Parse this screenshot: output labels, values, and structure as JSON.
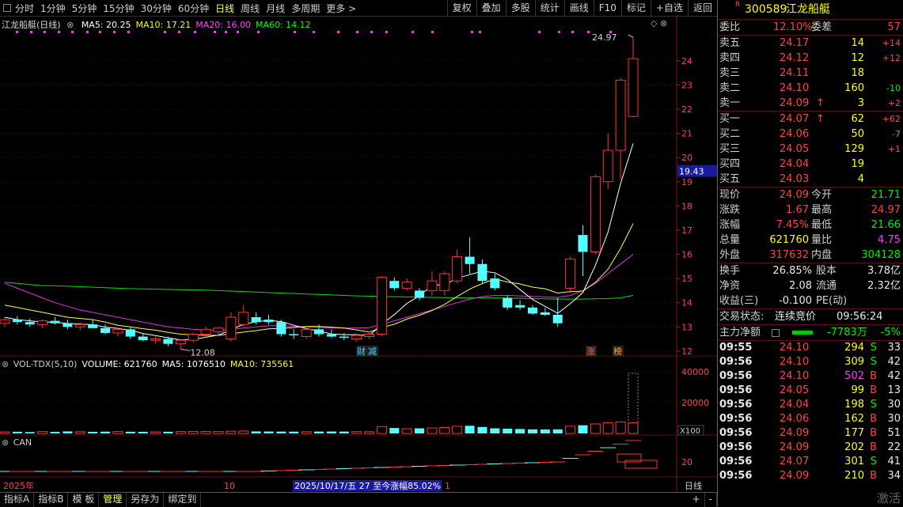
{
  "toolbar": {
    "periods": [
      "分时",
      "1分钟",
      "5分钟",
      "15分钟",
      "30分钟",
      "60分钟",
      "日线",
      "周线",
      "月线",
      "多周期",
      "更多 >"
    ],
    "active_period": "日线",
    "tools": [
      "复权",
      "叠加",
      "多股",
      "统计",
      "画线",
      "F10",
      "标记",
      "+自选",
      "返回"
    ]
  },
  "stock": {
    "code": "300589",
    "name": "江龙船艇",
    "badge": "R"
  },
  "ma_info": {
    "title": "江龙船艇(日线)",
    "items": [
      {
        "label": "MA5: 20.25",
        "color": "#ffffff"
      },
      {
        "label": "MA10: 17.21",
        "color": "#ffff00"
      },
      {
        "label": "MA20: 16.00",
        "color": "#ff44ff"
      },
      {
        "label": "MA60: 14.12",
        "color": "#00ff00"
      }
    ]
  },
  "vol_info": {
    "items": [
      {
        "label": "VOL-TDX(5,10)",
        "color": "#cccccc"
      },
      {
        "label": "VOLUME: 621760",
        "color": "#ffffff"
      },
      {
        "label": "MA5: 1076510",
        "color": "#ffffff"
      },
      {
        "label": "MA10: 735561",
        "color": "#ffff00"
      }
    ]
  },
  "can_info": {
    "label": "CAN"
  },
  "chart_labels": {
    "high_mark": "24.97",
    "low_mark": "12.08",
    "current_price": "19.43",
    "tag_cai": "财",
    "tag_jian": "减",
    "tag_zhang": "涨",
    "tag_bang": "榜",
    "vol_scale": "X100",
    "date_left": "2025年",
    "date_mid": "10",
    "date_range": "2025/10/17/五 27 至今涨幅85.02%",
    "date_end": "1"
  },
  "chart_data": {
    "type": "candlestick",
    "price_axis": {
      "ticks": [
        12,
        13,
        14,
        15,
        16,
        17,
        18,
        19,
        20,
        21,
        22,
        23,
        24
      ],
      "range": [
        11.8,
        25.4
      ]
    },
    "vol_axis": {
      "ticks": [
        20000,
        40000
      ]
    },
    "can_axis": {
      "ticks": [
        20
      ]
    },
    "candles": [
      {
        "o": 13.15,
        "h": 13.4,
        "l": 13.0,
        "c": 13.3
      },
      {
        "o": 13.3,
        "h": 13.45,
        "l": 13.1,
        "c": 13.2
      },
      {
        "o": 13.2,
        "h": 13.35,
        "l": 13.0,
        "c": 13.1
      },
      {
        "o": 13.1,
        "h": 13.3,
        "l": 12.95,
        "c": 13.25
      },
      {
        "o": 13.25,
        "h": 13.4,
        "l": 13.1,
        "c": 13.15
      },
      {
        "o": 13.15,
        "h": 13.3,
        "l": 12.9,
        "c": 13.0
      },
      {
        "o": 13.0,
        "h": 13.2,
        "l": 12.85,
        "c": 13.1
      },
      {
        "o": 13.1,
        "h": 13.3,
        "l": 12.95,
        "c": 12.95
      },
      {
        "o": 12.95,
        "h": 13.1,
        "l": 12.7,
        "c": 12.75
      },
      {
        "o": 12.75,
        "h": 12.95,
        "l": 12.6,
        "c": 12.9
      },
      {
        "o": 12.9,
        "h": 13.0,
        "l": 12.5,
        "c": 12.6
      },
      {
        "o": 12.6,
        "h": 12.75,
        "l": 12.4,
        "c": 12.45
      },
      {
        "o": 12.45,
        "h": 12.6,
        "l": 12.3,
        "c": 12.5
      },
      {
        "o": 12.5,
        "h": 12.6,
        "l": 12.2,
        "c": 12.3
      },
      {
        "o": 12.3,
        "h": 12.5,
        "l": 12.08,
        "c": 12.45
      },
      {
        "o": 12.45,
        "h": 12.75,
        "l": 12.35,
        "c": 12.7
      },
      {
        "o": 12.7,
        "h": 13.0,
        "l": 12.55,
        "c": 12.9
      },
      {
        "o": 12.8,
        "h": 13.0,
        "l": 12.6,
        "c": 12.95
      },
      {
        "o": 12.5,
        "h": 13.6,
        "l": 12.4,
        "c": 13.4
      },
      {
        "o": 13.1,
        "h": 13.9,
        "l": 13.0,
        "c": 13.6
      },
      {
        "o": 13.4,
        "h": 13.6,
        "l": 13.1,
        "c": 13.2
      },
      {
        "o": 13.3,
        "h": 13.5,
        "l": 13.1,
        "c": 13.2
      },
      {
        "o": 13.2,
        "h": 13.3,
        "l": 12.6,
        "c": 12.7
      },
      {
        "o": 12.7,
        "h": 12.9,
        "l": 12.5,
        "c": 12.65
      },
      {
        "o": 12.6,
        "h": 12.95,
        "l": 12.5,
        "c": 12.9
      },
      {
        "o": 12.9,
        "h": 13.1,
        "l": 12.6,
        "c": 12.7
      },
      {
        "o": 12.7,
        "h": 12.9,
        "l": 12.55,
        "c": 12.6
      },
      {
        "o": 12.6,
        "h": 12.75,
        "l": 12.45,
        "c": 12.55
      },
      {
        "o": 12.5,
        "h": 12.7,
        "l": 12.4,
        "c": 12.65
      },
      {
        "o": 12.6,
        "h": 12.8,
        "l": 12.5,
        "c": 12.7
      },
      {
        "o": 12.7,
        "h": 15.1,
        "l": 12.6,
        "c": 15.05
      },
      {
        "o": 14.9,
        "h": 15.05,
        "l": 14.5,
        "c": 14.6
      },
      {
        "o": 14.6,
        "h": 15.0,
        "l": 14.5,
        "c": 14.85
      },
      {
        "o": 14.5,
        "h": 14.6,
        "l": 14.1,
        "c": 14.2
      },
      {
        "o": 14.5,
        "h": 15.3,
        "l": 14.3,
        "c": 14.9
      },
      {
        "o": 14.5,
        "h": 15.3,
        "l": 14.3,
        "c": 15.2
      },
      {
        "o": 14.9,
        "h": 16.2,
        "l": 14.8,
        "c": 15.9
      },
      {
        "o": 15.9,
        "h": 16.7,
        "l": 15.2,
        "c": 15.6
      },
      {
        "o": 15.6,
        "h": 15.8,
        "l": 14.8,
        "c": 14.9
      },
      {
        "o": 15.0,
        "h": 15.2,
        "l": 14.5,
        "c": 14.6
      },
      {
        "o": 14.2,
        "h": 14.3,
        "l": 13.7,
        "c": 13.8
      },
      {
        "o": 13.9,
        "h": 14.1,
        "l": 13.7,
        "c": 13.8
      },
      {
        "o": 13.8,
        "h": 13.9,
        "l": 13.5,
        "c": 13.55
      },
      {
        "o": 13.6,
        "h": 13.8,
        "l": 13.45,
        "c": 13.5
      },
      {
        "o": 13.5,
        "h": 14.2,
        "l": 13.0,
        "c": 13.15
      },
      {
        "o": 14.6,
        "h": 15.9,
        "l": 14.4,
        "c": 15.8
      },
      {
        "o": 16.8,
        "h": 17.2,
        "l": 15.1,
        "c": 16.1
      },
      {
        "o": 16.1,
        "h": 19.3,
        "l": 16.0,
        "c": 19.2
      },
      {
        "o": 19.0,
        "h": 21.0,
        "l": 18.7,
        "c": 20.3
      },
      {
        "o": 20.3,
        "h": 23.3,
        "l": 19.1,
        "c": 23.2
      },
      {
        "o": 21.7,
        "h": 24.97,
        "l": 21.66,
        "c": 24.09
      }
    ],
    "volumes": [
      900,
      1000,
      800,
      1100,
      900,
      1200,
      1000,
      950,
      1050,
      1100,
      1000,
      950,
      900,
      1000,
      1100,
      1200,
      1150,
      1100,
      1300,
      1400,
      1200,
      1150,
      1100,
      1050,
      1000,
      1100,
      1150,
      1100,
      1050,
      1000,
      4000,
      3200,
      2800,
      3000,
      3200,
      3500,
      4200,
      4500,
      3800,
      3000,
      2800,
      2600,
      2400,
      2300,
      2400,
      4200,
      4800,
      5600,
      6300,
      6800,
      6217
    ]
  },
  "quote": {
    "weibi": "12.10%",
    "weicha": "57",
    "asks": [
      {
        "label": "卖五",
        "price": "24.17",
        "vol": "14",
        "chg": "+14"
      },
      {
        "label": "卖四",
        "price": "24.12",
        "vol": "12",
        "chg": "+12"
      },
      {
        "label": "卖三",
        "price": "24.11",
        "vol": "18",
        "chg": ""
      },
      {
        "label": "卖二",
        "price": "24.10",
        "vol": "160",
        "chg": "-10"
      },
      {
        "label": "卖一",
        "price": "24.09",
        "vol": "3",
        "chg": "+2",
        "arrow": "↑"
      }
    ],
    "bids": [
      {
        "label": "买一",
        "price": "24.07",
        "vol": "62",
        "chg": "+62",
        "arrow": "↑"
      },
      {
        "label": "买二",
        "price": "24.06",
        "vol": "50",
        "chg": "-7"
      },
      {
        "label": "买三",
        "price": "24.05",
        "vol": "129",
        "chg": "+1"
      },
      {
        "label": "买四",
        "price": "24.04",
        "vol": "19",
        "chg": ""
      },
      {
        "label": "买五",
        "price": "24.03",
        "vol": "4",
        "chg": ""
      }
    ],
    "stats": [
      {
        "l1": "现价",
        "v1": "24.09",
        "c1": "red",
        "l2": "今开",
        "v2": "21.71",
        "c2": "green"
      },
      {
        "l1": "涨跌",
        "v1": "1.67",
        "c1": "red",
        "l2": "最高",
        "v2": "24.97",
        "c2": "red"
      },
      {
        "l1": "涨幅",
        "v1": "7.45%",
        "c1": "red",
        "l2": "最低",
        "v2": "21.66",
        "c2": "green"
      },
      {
        "l1": "总量",
        "v1": "621760",
        "c1": "yellow",
        "l2": "量比",
        "v2": "4.75",
        "c2": "mag"
      },
      {
        "l1": "外盘",
        "v1": "317632",
        "c1": "red",
        "l2": "内盘",
        "v2": "304128",
        "c2": "green"
      }
    ],
    "stats2": [
      {
        "l1": "换手",
        "v1": "26.85%",
        "l2": "股本",
        "v2": "3.78亿"
      },
      {
        "l1": "净资",
        "v1": "2.08",
        "l2": "流通",
        "v2": "2.32亿"
      },
      {
        "l1": "收益(三)",
        "v1": "-0.100",
        "l2": "PE(动)",
        "v2": ""
      }
    ],
    "trade_state_label": "交易状态:",
    "trade_state": "连续竞价",
    "trade_time": "09:56:24",
    "net_label": "主力净额",
    "net_value": "-7783万",
    "net_pct": "-5%"
  },
  "ticks": [
    {
      "t": "09:55",
      "p": "24.10",
      "v": "294",
      "s": "S",
      "n": "33"
    },
    {
      "t": "09:56",
      "p": "24.10",
      "v": "309",
      "s": "S",
      "n": "42"
    },
    {
      "t": "09:56",
      "p": "24.10",
      "v": "502",
      "s": "B",
      "n": "42"
    },
    {
      "t": "09:56",
      "p": "24.05",
      "v": "99",
      "s": "B",
      "n": "13"
    },
    {
      "t": "09:56",
      "p": "24.04",
      "v": "198",
      "s": "S",
      "n": "30"
    },
    {
      "t": "09:56",
      "p": "24.06",
      "v": "162",
      "s": "B",
      "n": "30"
    },
    {
      "t": "09:56",
      "p": "24.09",
      "v": "177",
      "s": "B",
      "n": "51"
    },
    {
      "t": "09:56",
      "p": "24.09",
      "v": "202",
      "s": "B",
      "n": "22"
    },
    {
      "t": "09:56",
      "p": "24.07",
      "v": "301",
      "s": "S",
      "n": "41"
    },
    {
      "t": "09:56",
      "p": "24.09",
      "v": "210",
      "s": "B",
      "n": "34"
    }
  ],
  "bottom": {
    "tabs": [
      "指标A",
      "指标B",
      "模 板",
      "管理",
      "另存为",
      "绑定到"
    ],
    "active": "管理",
    "right": [
      "+",
      "-"
    ],
    "period_label": "日线",
    "activate": "激活"
  }
}
